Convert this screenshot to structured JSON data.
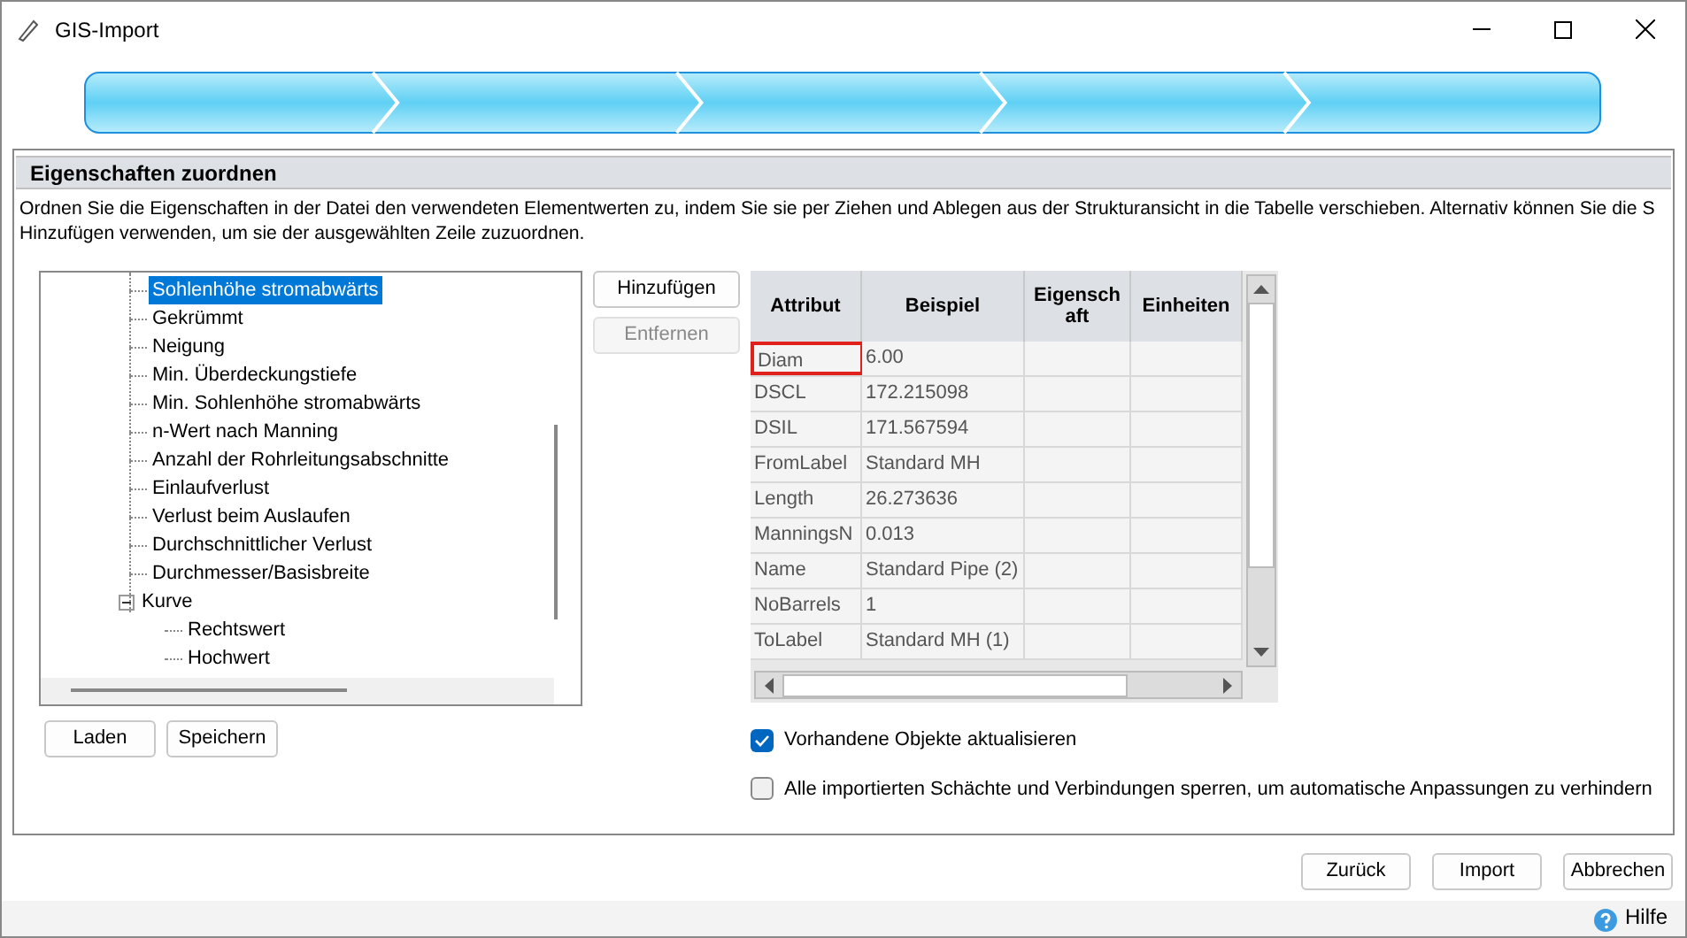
{
  "window": {
    "title": "GIS-Import"
  },
  "section": {
    "title": "Eigenschaften zuordnen",
    "description": [
      "Ordnen Sie die Eigenschaften in der Datei den verwendeten Elementwerten zu, indem Sie sie per Ziehen und Ablegen aus der Strukturansicht in die Tabelle verschieben. Alternativ können Sie die S",
      "Hinzufügen verwenden, um sie der ausgewählten Zeile zuzuordnen."
    ]
  },
  "tree": {
    "items": [
      {
        "label": "Sohlenhöhe stromabwärts",
        "selected": true
      },
      {
        "label": "Gekrümmt",
        "selected": false
      },
      {
        "label": "Neigung",
        "selected": false
      },
      {
        "label": "Min. Überdeckungstiefe",
        "selected": false
      },
      {
        "label": "Min. Sohlenhöhe stromabwärts",
        "selected": false
      },
      {
        "label": "n-Wert nach Manning",
        "selected": false
      },
      {
        "label": "Anzahl der Rohrleitungsabschnitte",
        "selected": false
      },
      {
        "label": "Einlaufverlust",
        "selected": false
      },
      {
        "label": "Verlust beim Auslaufen",
        "selected": false
      },
      {
        "label": "Durchschnittlicher Verlust",
        "selected": false
      },
      {
        "label": "Durchmesser/Basisbreite",
        "selected": false
      },
      {
        "label": "Kurve",
        "selected": false,
        "expanded": true,
        "children": [
          {
            "label": "Rechtswert",
            "selected": false
          },
          {
            "label": "Hochwert",
            "selected": false
          }
        ]
      }
    ]
  },
  "tree_buttons": [
    {
      "label": "Laden",
      "disabled": false
    },
    {
      "label": "Speichern",
      "disabled": false
    }
  ],
  "side_buttons": [
    {
      "label": "Hinzufügen",
      "disabled": false
    },
    {
      "label": "Entfernen",
      "disabled": true
    }
  ],
  "table": {
    "columns": [
      "Attribut",
      "Beispiel",
      "Eigenschaft",
      "Einheiten"
    ],
    "rows": [
      {
        "cells": [
          "Diam",
          "6.00",
          "",
          ""
        ],
        "selected": true
      },
      {
        "cells": [
          "DSCL",
          "172.215098",
          "",
          ""
        ],
        "selected": false
      },
      {
        "cells": [
          "DSIL",
          "171.567594",
          "",
          ""
        ],
        "selected": false
      },
      {
        "cells": [
          "FromLabel",
          "Standard MH",
          "",
          ""
        ],
        "selected": false
      },
      {
        "cells": [
          "Length",
          "26.273636",
          "",
          ""
        ],
        "selected": false
      },
      {
        "cells": [
          "ManningsN",
          "0.013",
          "",
          ""
        ],
        "selected": false
      },
      {
        "cells": [
          "Name",
          "Standard Pipe (2)",
          "",
          ""
        ],
        "selected": false
      },
      {
        "cells": [
          "NoBarrels",
          "1",
          "",
          ""
        ],
        "selected": false
      },
      {
        "cells": [
          "ToLabel",
          "Standard MH (1)",
          "",
          ""
        ],
        "selected": false
      }
    ]
  },
  "options": [
    {
      "label": "Vorhandene Objekte aktualisieren",
      "checked": true
    },
    {
      "label": "Alle importierten Schächte und Verbindungen sperren, um automatische Anpassungen zu verhindern",
      "checked": false
    }
  ],
  "buttons": [
    {
      "label": "Zurück"
    },
    {
      "label": "Import"
    },
    {
      "label": "Abbrechen"
    }
  ],
  "help": {
    "label": "Hilfe"
  }
}
